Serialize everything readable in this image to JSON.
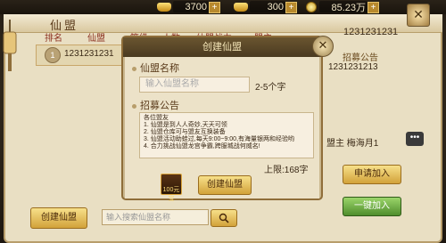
{
  "resources": {
    "gold": "3700",
    "silver": "300",
    "coins": "85.23万"
  },
  "window": {
    "title": "仙盟"
  },
  "table": {
    "headers": [
      "排名",
      "仙盟",
      "等级",
      "人数",
      "仙盟战力",
      "盟主"
    ],
    "rows": [
      {
        "rank": "1",
        "name": "1231231231"
      }
    ]
  },
  "detail": {
    "id": "1231231231",
    "notice_label": "招募公告",
    "number": "1231231213",
    "leader": "盟主 梅海月1"
  },
  "dialog": {
    "title": "创建仙盟",
    "name_label": "仙盟名称",
    "name_placeholder": "输入仙盟名称",
    "name_hint": "2-5个字",
    "notice_label": "招募公告",
    "notice_lines": [
      "各位盟友",
      "1. 仙盟是到人人奇妙,天天可领",
      "2. 仙盟仓库可与盟友互换装备",
      "3. 仙盟活动助蛙过,每天9:00~9:00,有海量银两和经验哟",
      "4. 合力挑战仙盟龙宫争霸,跨服城战何威名!"
    ],
    "limit": "上限:168字",
    "cost": "100元宝",
    "confirm_label": "创建仙盟",
    "close_label": "✕"
  },
  "footer": {
    "create_label": "创建仙盟",
    "search_placeholder": "输入搜索仙盟名称",
    "search_icon": "search-icon",
    "apply_label": "申请加入",
    "onekey_label": "一键加入"
  },
  "colors": {
    "accent": "#8b2f1f",
    "gold": "#d2a23a",
    "green": "#4f8d2c"
  }
}
